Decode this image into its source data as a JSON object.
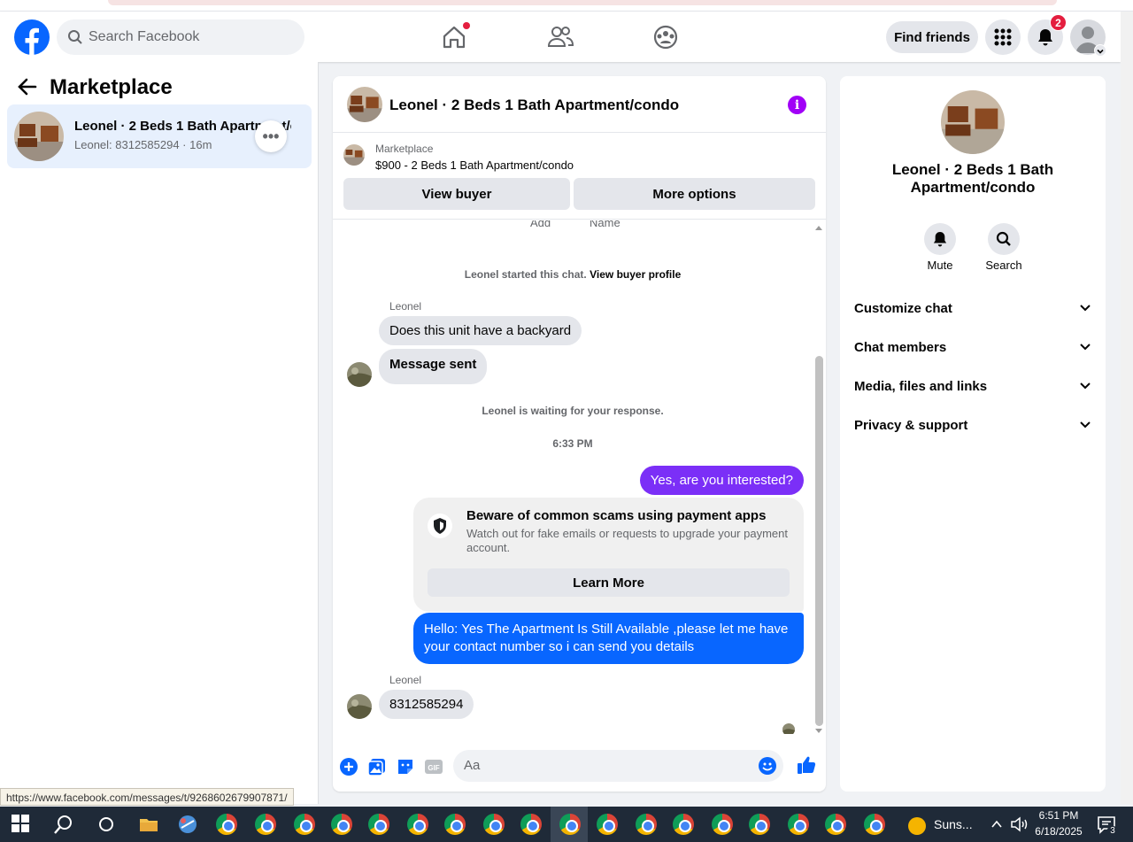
{
  "header": {
    "search_placeholder": "Search Facebook",
    "find_friends": "Find friends",
    "notification_count": "2"
  },
  "sidebar": {
    "title": "Marketplace",
    "conversation": {
      "title": "Leonel · 2 Beds 1 Bath Apartment/c...",
      "subtitle": "Leonel: 8312585294 · 16m"
    }
  },
  "chat": {
    "title": "Leonel · 2 Beds 1 Bath Apartment/condo",
    "context_label": "Marketplace",
    "context_listing": "$900 - 2 Beds 1 Bath Apartment/condo",
    "view_buyer": "View buyer",
    "more_options": "More options",
    "cut_labels": [
      "Add",
      "Name"
    ],
    "started_text": "Leonel started this chat.",
    "view_buyer_profile": "View buyer profile",
    "sender_name": "Leonel",
    "msg1": "Does this unit have a backyard",
    "msg2": "Message sent",
    "waiting_text": "Leonel is waiting for your response.",
    "time": "6:33 PM",
    "out1": "Yes, are you interested?",
    "scam_title": "Beware of common scams using payment apps",
    "scam_desc": "Watch out for fake emails or requests to upgrade your payment account.",
    "learn_more": "Learn More",
    "out2": "Hello: Yes The Apartment Is Still Available ,please let me have your contact number so i can send you details",
    "sender_name2": "Leonel",
    "msg3": "8312585294",
    "input_placeholder": "Aa"
  },
  "details": {
    "title": "Leonel · 2 Beds 1 Bath Apartment/condo",
    "mute": "Mute",
    "search": "Search",
    "sections": [
      "Customize chat",
      "Chat members",
      "Media, files and links",
      "Privacy & support"
    ]
  },
  "status_url": "https://www.facebook.com/messages/t/9268602679907871/",
  "taskbar": {
    "weather": "Suns...",
    "time": "6:51 PM",
    "date": "6/18/2025",
    "notif_count": "3"
  },
  "colors": {
    "fb_blue": "#0866ff",
    "purple_bubble": "#7b2ff7",
    "info_purple": "#a100f7"
  }
}
